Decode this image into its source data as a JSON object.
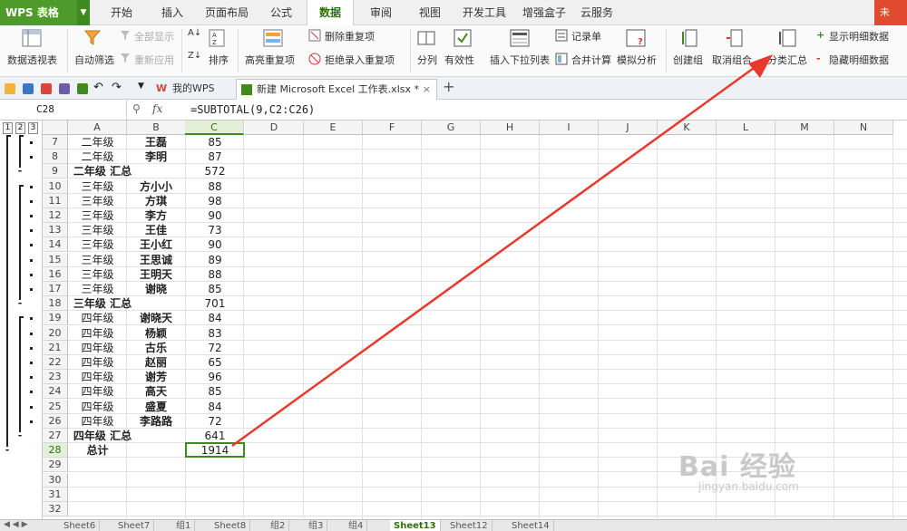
{
  "app": {
    "name": "WPS 表格",
    "top_right": "未"
  },
  "menu": {
    "tabs": [
      "开始",
      "插入",
      "页面布局",
      "公式",
      "数据",
      "审阅",
      "视图",
      "开发工具",
      "增强盒子",
      "云服务"
    ],
    "active": "数据"
  },
  "ribbon": {
    "pivot": "数据透视表",
    "autofilter": "自动筛选",
    "show_all": "全部显示",
    "reapply": "重新应用",
    "sort": "排序",
    "highlight_dup": "高亮重复项",
    "remove_dup": "删除重复项",
    "reject_dup": "拒绝录入重复项",
    "split": "分列",
    "validity": "有效性",
    "insert_dropdown": "插入下拉列表",
    "record_form": "记录单",
    "consolidate": "合并计算",
    "simulate": "模拟分析",
    "create_group": "创建组",
    "ungroup": "取消组合",
    "subtotal": "分类汇总",
    "show_detail": "显示明细数据",
    "hide_detail": "隐藏明细数据"
  },
  "quickbar": {
    "my_wps": "我的WPS",
    "doc_tab": "新建 Microsoft Excel 工作表.xlsx *",
    "plus": "+"
  },
  "formula_bar": {
    "name_box": "C28",
    "fx": "fx",
    "formula": "=SUBTOTAL(9,C2:C26)"
  },
  "outline_levels": [
    "1",
    "2",
    "3"
  ],
  "columns": [
    "A",
    "B",
    "C",
    "D",
    "E",
    "F",
    "G",
    "H",
    "I",
    "J",
    "K",
    "L",
    "M",
    "N"
  ],
  "selected_column": "C",
  "rows": [
    {
      "num": "7",
      "a": "二年级",
      "b": "王磊",
      "c": "85",
      "outline": "dot"
    },
    {
      "num": "8",
      "a": "二年级",
      "b": "李明",
      "c": "87",
      "outline": "dot"
    },
    {
      "num": "9",
      "a": "二年级 汇总",
      "b": "",
      "c": "572",
      "outline": "minus",
      "summary": true
    },
    {
      "num": "10",
      "a": "三年级",
      "b": "方小小",
      "c": "88",
      "outline": "dot"
    },
    {
      "num": "11",
      "a": "三年级",
      "b": "方琪",
      "c": "98",
      "outline": "dot"
    },
    {
      "num": "12",
      "a": "三年级",
      "b": "李方",
      "c": "90",
      "outline": "dot"
    },
    {
      "num": "13",
      "a": "三年级",
      "b": "王佳",
      "c": "73",
      "outline": "dot"
    },
    {
      "num": "14",
      "a": "三年级",
      "b": "王小红",
      "c": "90",
      "outline": "dot"
    },
    {
      "num": "15",
      "a": "三年级",
      "b": "王思诚",
      "c": "89",
      "outline": "dot"
    },
    {
      "num": "16",
      "a": "三年级",
      "b": "王明天",
      "c": "88",
      "outline": "dot"
    },
    {
      "num": "17",
      "a": "三年级",
      "b": "谢晓",
      "c": "85",
      "outline": "dot"
    },
    {
      "num": "18",
      "a": "三年级 汇总",
      "b": "",
      "c": "701",
      "outline": "minus",
      "summary": true
    },
    {
      "num": "19",
      "a": "四年级",
      "b": "谢晓天",
      "c": "84",
      "outline": "dot"
    },
    {
      "num": "20",
      "a": "四年级",
      "b": "杨颖",
      "c": "83",
      "outline": "dot"
    },
    {
      "num": "21",
      "a": "四年级",
      "b": "古乐",
      "c": "72",
      "outline": "dot"
    },
    {
      "num": "22",
      "a": "四年级",
      "b": "赵丽",
      "c": "65",
      "outline": "dot"
    },
    {
      "num": "23",
      "a": "四年级",
      "b": "谢芳",
      "c": "96",
      "outline": "dot"
    },
    {
      "num": "24",
      "a": "四年级",
      "b": "高天",
      "c": "85",
      "outline": "dot"
    },
    {
      "num": "25",
      "a": "四年级",
      "b": "盛夏",
      "c": "84",
      "outline": "dot"
    },
    {
      "num": "26",
      "a": "四年级",
      "b": "李路路",
      "c": "72",
      "outline": "dot"
    },
    {
      "num": "27",
      "a": "四年级 汇总",
      "b": "",
      "c": "641",
      "outline": "minus",
      "summary": true
    },
    {
      "num": "28",
      "a": "总计",
      "b": "",
      "c": "1914",
      "outline": "minus",
      "summary": true,
      "total": true
    },
    {
      "num": "29",
      "a": "",
      "b": "",
      "c": "",
      "outline": ""
    },
    {
      "num": "30",
      "a": "",
      "b": "",
      "c": "",
      "outline": ""
    },
    {
      "num": "31",
      "a": "",
      "b": "",
      "c": "",
      "outline": ""
    },
    {
      "num": "32",
      "a": "",
      "b": "",
      "c": "",
      "outline": ""
    }
  ],
  "sheet_tabs": [
    "Sheet6",
    "Sheet7",
    "组1",
    "Sheet8",
    "组2",
    "组3",
    "组4",
    "Sheet13",
    "Sheet12",
    "Sheet14"
  ],
  "active_sheet": "Sheet13",
  "watermark": {
    "logo": "Bai 经验",
    "url": "jingyan.baidu.com"
  },
  "colors": {
    "accent": "#3f8a1f",
    "arrow": "#e8392b"
  }
}
